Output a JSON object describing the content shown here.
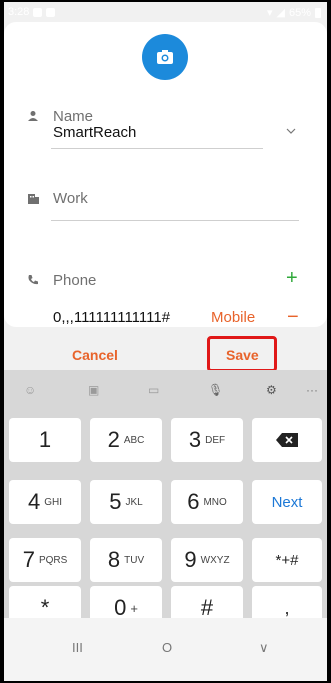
{
  "status": {
    "time": "3:28",
    "battery": "65%"
  },
  "form": {
    "name_label": "Name",
    "name_value": "SmartReach",
    "work_label": "Work",
    "phone_label": "Phone",
    "phone_value": "0,,,111111111111#",
    "phone_type": "Mobile",
    "add_symbol": "+",
    "remove_symbol": "−"
  },
  "actions": {
    "cancel": "Cancel",
    "save": "Save"
  },
  "keyboard": {
    "keys": [
      {
        "num": "1",
        "sub": ""
      },
      {
        "num": "2",
        "sub": "ABC"
      },
      {
        "num": "3",
        "sub": "DEF"
      },
      {
        "num": "4",
        "sub": "GHI"
      },
      {
        "num": "5",
        "sub": "JKL"
      },
      {
        "num": "6",
        "sub": "MNO"
      },
      {
        "num": "7",
        "sub": "PQRS"
      },
      {
        "num": "8",
        "sub": "TUV"
      },
      {
        "num": "9",
        "sub": "WXYZ"
      },
      {
        "num": "*",
        "sub": ""
      },
      {
        "num": "0",
        "sub": "+"
      },
      {
        "num": "#",
        "sub": ""
      }
    ],
    "next": "Next",
    "symbols": "*+#",
    "comma": ","
  },
  "nav": {
    "recent": "III",
    "home": "O",
    "back": "∨"
  },
  "colors": {
    "accent": "#1c8adb",
    "orange": "#e8632b",
    "green": "#2fa83a",
    "highlight": "#e01818"
  }
}
